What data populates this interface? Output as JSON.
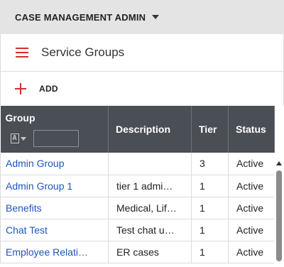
{
  "app": {
    "title": "CASE MANAGEMENT ADMIN"
  },
  "header": {
    "title": "Service Groups"
  },
  "toolbar": {
    "add_label": "ADD"
  },
  "table": {
    "columns": {
      "group": "Group",
      "description": "Description",
      "tier": "Tier",
      "status": "Status"
    },
    "filter": {
      "type_icon_label": "[A]",
      "value": ""
    },
    "rows": [
      {
        "group": "Admin Group",
        "description": "",
        "tier": "3",
        "status": "Active"
      },
      {
        "group": "Admin Group 1",
        "description": "tier 1 admi…",
        "tier": "1",
        "status": "Active"
      },
      {
        "group": "Benefits",
        "description": "Medical, Lif…",
        "tier": "1",
        "status": "Active"
      },
      {
        "group": "Chat Test",
        "description": "Test chat u…",
        "tier": "1",
        "status": "Active"
      },
      {
        "group": "Employee Relati…",
        "description": "ER cases",
        "tier": "1",
        "status": "Active"
      }
    ]
  },
  "icons": {
    "menu": "hamburger-menu-icon",
    "add": "plus-icon",
    "app_dropdown": "caret-down-icon",
    "filter_type": "text-filter-icon",
    "scroll_up": "scroll-up-arrow-icon"
  },
  "colors": {
    "accent": "#d32f2f",
    "link": "#1f56b8",
    "table_header": "#4a4e55",
    "topbar": "#e4e4e4"
  }
}
